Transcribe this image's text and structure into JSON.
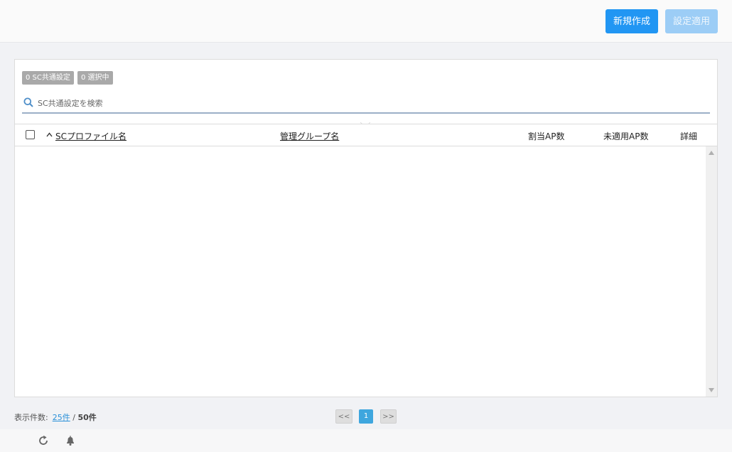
{
  "toolbar": {
    "new_label": "新規作成",
    "apply_label": "設定適用"
  },
  "badges": {
    "total": "0 SC共通設定",
    "selected": "0 選択中"
  },
  "search": {
    "placeholder": "SC共通設定を検索"
  },
  "table": {
    "columns": {
      "profile_name": "SCプロファイル名",
      "group_name": "管理グループ名",
      "assigned_ap": "割当AP数",
      "unapplied_ap": "未適用AP数",
      "details": "詳細"
    },
    "sort_indicator": "^",
    "rows": []
  },
  "footer": {
    "count_label": "表示件数:",
    "per_page": "25件",
    "separator": "/",
    "total": "50件"
  },
  "pager": {
    "prev": "<<",
    "current": "1",
    "next": ">>"
  },
  "icons": {
    "search": "search-icon",
    "sort": "sort-asc-icon",
    "refresh": "refresh-icon",
    "bell": "bell-icon"
  },
  "colors": {
    "primary": "#2196f3",
    "primary_disabled": "#9ccdf6",
    "badge": "#a9a9a9",
    "pager_active": "#3ea6de",
    "link": "#2a90d8"
  }
}
